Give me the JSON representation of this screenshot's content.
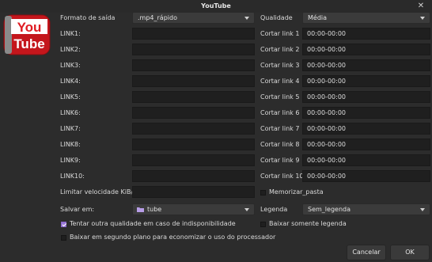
{
  "window": {
    "title": "YouTube"
  },
  "logo": {
    "top": "You",
    "bottom": "Tube"
  },
  "format": {
    "label": "Formato de saída",
    "value": ".mp4_rápido"
  },
  "quality": {
    "label": "Qualidade",
    "value": "Média"
  },
  "links": [
    {
      "label": "LINK1:",
      "value": "",
      "cut_label": "Cortar link 1",
      "cut_value": "00:00-00:00"
    },
    {
      "label": "LINK2:",
      "value": "",
      "cut_label": "Cortar link 2",
      "cut_value": "00:00-00:00"
    },
    {
      "label": "LINK3:",
      "value": "",
      "cut_label": "Cortar link 3",
      "cut_value": "00:00-00:00"
    },
    {
      "label": "LINK4:",
      "value": "",
      "cut_label": "Cortar link 4",
      "cut_value": "00:00-00:00"
    },
    {
      "label": "LINK5:",
      "value": "",
      "cut_label": "Cortar link 5",
      "cut_value": "00:00-00:00"
    },
    {
      "label": "LINK6:",
      "value": "",
      "cut_label": "Cortar link 6",
      "cut_value": "00:00-00:00"
    },
    {
      "label": "LINK7:",
      "value": "",
      "cut_label": "Cortar link 7",
      "cut_value": "00:00-00:00"
    },
    {
      "label": "LINK8:",
      "value": "",
      "cut_label": "Cortar link 8",
      "cut_value": "00:00-00:00"
    },
    {
      "label": "LINK9:",
      "value": "",
      "cut_label": "Cortar link 9",
      "cut_value": "00:00-00:00"
    },
    {
      "label": "LINK10:",
      "value": "",
      "cut_label": "Cortar link 10",
      "cut_value": "00:00-00:00"
    }
  ],
  "speed_limit": {
    "label": "Limitar velocidade KiB/s:",
    "value": ""
  },
  "remember_paste": {
    "label": "Memorizar_pasta",
    "checked": false
  },
  "save_in": {
    "label": "Salvar em:",
    "value": "tube",
    "icon": "folder-icon"
  },
  "subtitle": {
    "label": "Legenda",
    "value": "Sem_legenda"
  },
  "try_other_quality": {
    "label": "Tentar outra qualidade em caso de indisponibilidade",
    "checked": true
  },
  "subtitle_only": {
    "label": "Baixar somente legenda",
    "checked": false
  },
  "background_download": {
    "label": "Baixar em segundo plano para economizar o uso do processador",
    "checked": false
  },
  "buttons": {
    "cancel": "Cancelar",
    "ok": "OK"
  },
  "colors": {
    "window_bg": "#2c2c2c",
    "field_bg": "#1f1f1f",
    "checkbox_accent": "#9a79d8",
    "logo_red": "#c4161c"
  }
}
